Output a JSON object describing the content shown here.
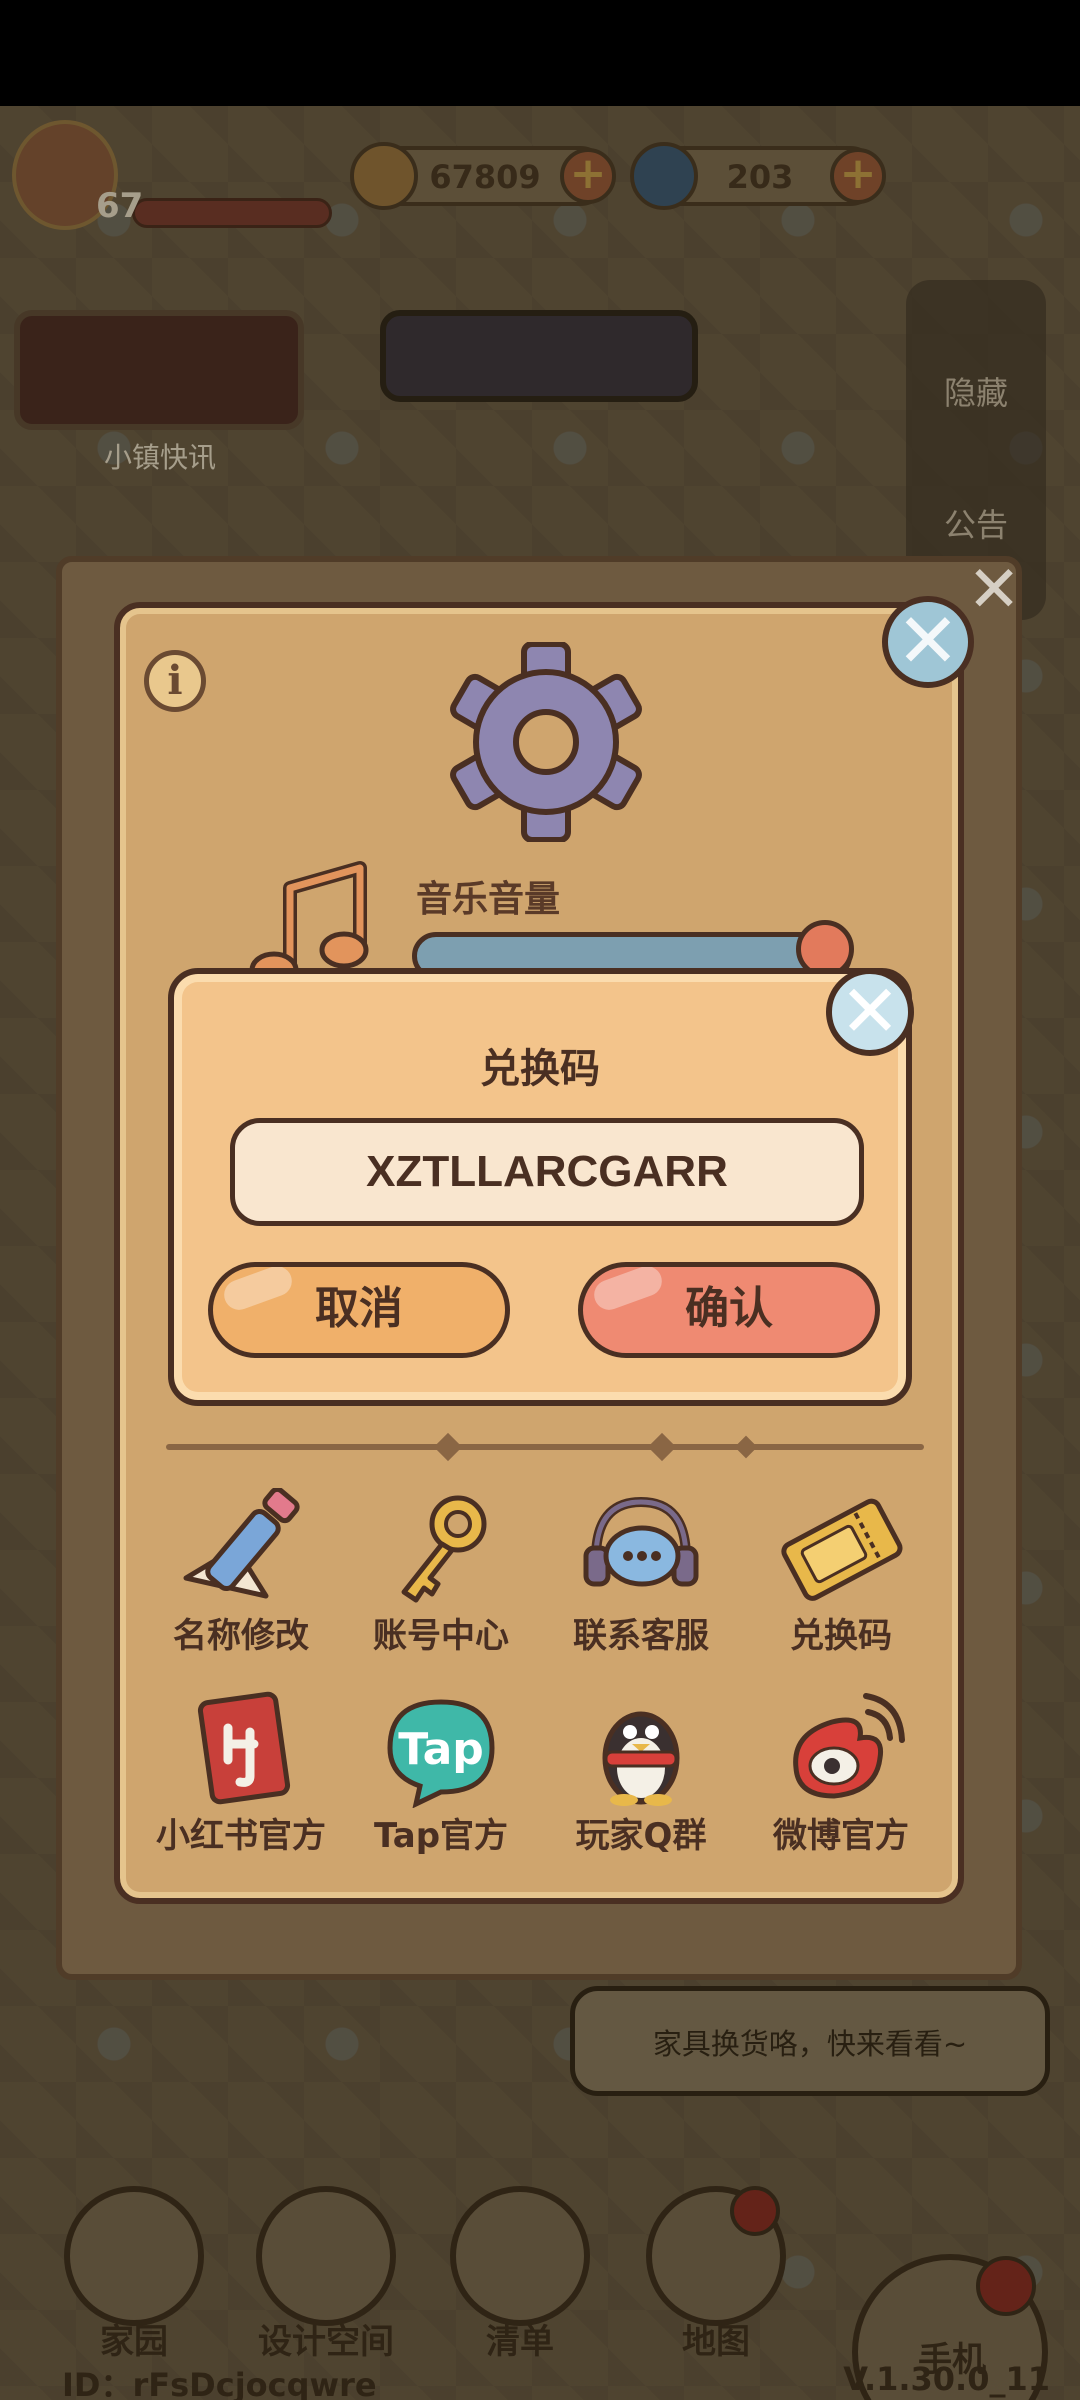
{
  "hud": {
    "level": "67",
    "coins": "67809",
    "gems": "203"
  },
  "background": {
    "news_label": "小镇快讯",
    "hide_label": "隐藏",
    "notice_label": "公告",
    "speech_text": "家具换货咯，快来看看~",
    "nav": [
      "家园",
      "设计空间",
      "清单",
      "地图",
      "手机"
    ],
    "player_id": "ID：rFsDcjocqwre",
    "version": "V.1.30.0_11"
  },
  "settings": {
    "music_label": "音乐音量",
    "music_volume": 0.95,
    "items": [
      {
        "label": "名称修改",
        "icon": "pencil-icon"
      },
      {
        "label": "账号中心",
        "icon": "key-icon"
      },
      {
        "label": "联系客服",
        "icon": "headset-icon"
      },
      {
        "label": "兑换码",
        "icon": "ticket-icon"
      },
      {
        "label": "小红书官方",
        "icon": "xiaohongshu-icon"
      },
      {
        "label": "Tap官方",
        "icon": "tap-icon"
      },
      {
        "label": "玩家Q群",
        "icon": "qq-penguin-icon"
      },
      {
        "label": "微博官方",
        "icon": "weibo-icon"
      }
    ]
  },
  "redeem": {
    "title": "兑换码",
    "code_value": "XZTLLARCGARR",
    "cancel_label": "取消",
    "confirm_label": "确认"
  }
}
